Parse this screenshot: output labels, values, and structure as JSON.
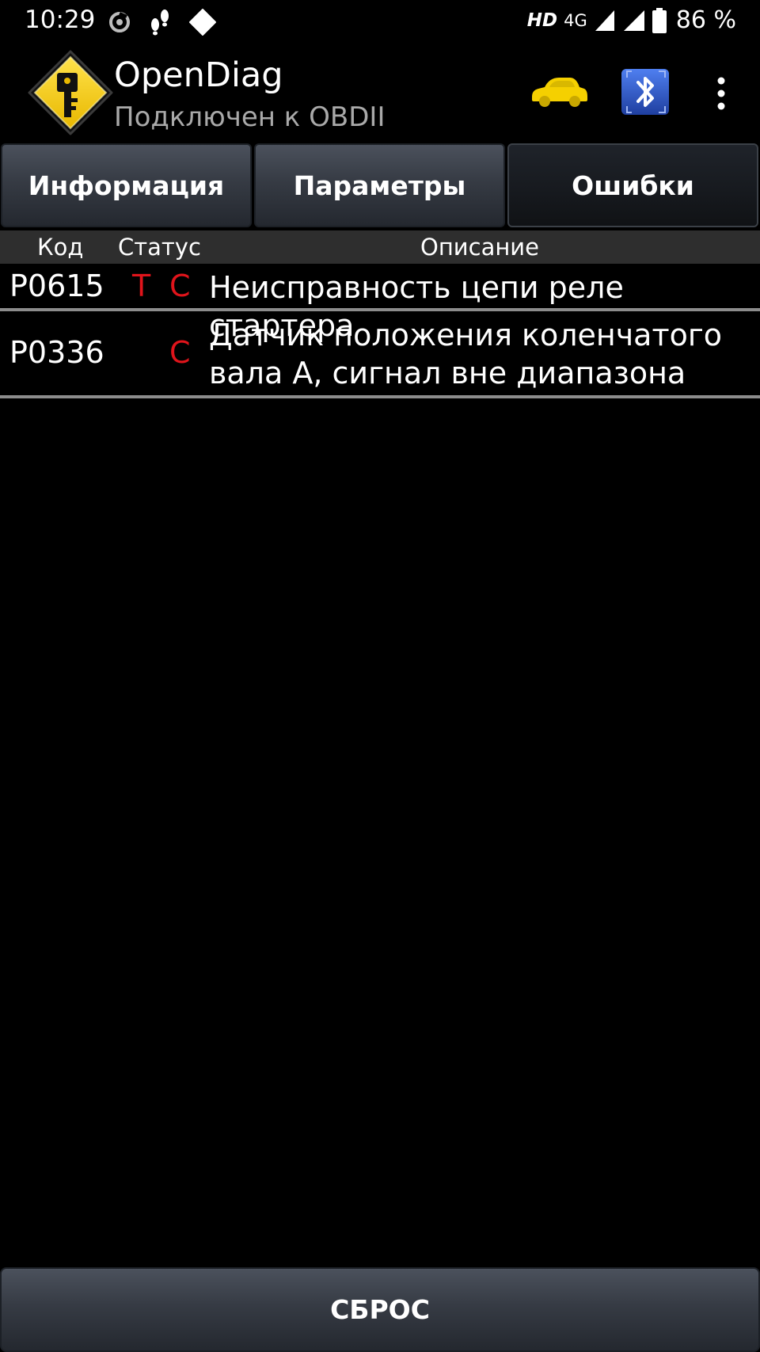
{
  "status_bar": {
    "time": "10:29",
    "network_hd": "HD",
    "network_type": "4G",
    "battery_percent": "86 %",
    "icons": [
      "sync-icon",
      "steps-icon",
      "diamond-icon",
      "signal-icon",
      "wifi-signal-icon",
      "battery-icon"
    ]
  },
  "app_bar": {
    "title": "OpenDiag",
    "subtitle": "Подключен к OBDII",
    "logo_icon": "key-warning-sign-icon",
    "car_icon_color": "#f5d000",
    "bluetooth_icon_color": "#2f56c9"
  },
  "tabs": [
    {
      "label": "Информация",
      "active": false
    },
    {
      "label": "Параметры",
      "active": false
    },
    {
      "label": "Ошибки",
      "active": true
    }
  ],
  "table": {
    "headers": {
      "code": "Код",
      "status": "Статус",
      "description": "Описание"
    },
    "rows": [
      {
        "code": "P0615",
        "status_t": "T",
        "status_c": "C",
        "description": "Неисправность цепи реле стартера"
      },
      {
        "code": "P0336",
        "status_t": "",
        "status_c": "C",
        "description": "Датчик положения коленчатого вала А, сигнал вне диапазона"
      }
    ]
  },
  "reset_button": {
    "label": "СБРОС"
  },
  "colors": {
    "status_red": "#e0141b",
    "subtitle_gray": "#a9a9a9",
    "header_bg": "#2e2e2e",
    "row_divider": "#8c8c8c"
  }
}
